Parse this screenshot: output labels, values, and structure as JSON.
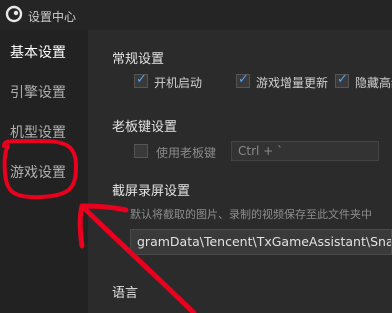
{
  "window": {
    "title": "设置中心",
    "accent": "#4aa3ff"
  },
  "sidebar": {
    "items": [
      {
        "label": "基本设置",
        "active": true
      },
      {
        "label": "引擎设置",
        "active": false
      },
      {
        "label": "机型设置",
        "active": false
      },
      {
        "label": "游戏设置",
        "active": false
      }
    ]
  },
  "general": {
    "title": "常规设置",
    "options": [
      {
        "label": "开机启动",
        "checked": true
      },
      {
        "label": "游戏增量更新",
        "checked": true
      },
      {
        "label": "隐藏高级",
        "checked": true
      }
    ]
  },
  "bosskey": {
    "title": "老板键设置",
    "enable_label": "使用老板键",
    "checked": false,
    "hotkey": "Ctrl + `"
  },
  "screenshot": {
    "title": "截屏录屏设置",
    "description": "默认将截取的图片、录制的视频保存至此文件夹中",
    "path": "gramData\\Tencent\\TxGameAssistant\\Snap"
  },
  "language": {
    "title": "语言"
  },
  "annotation": {
    "color": "#e8001e"
  }
}
